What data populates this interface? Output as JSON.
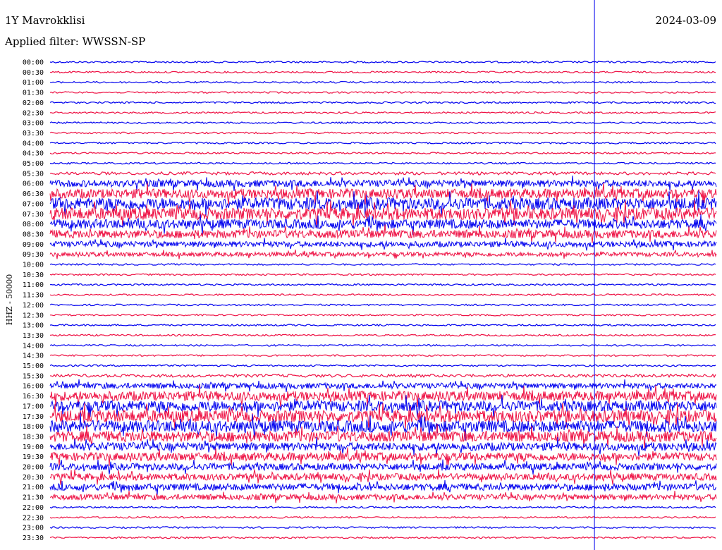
{
  "header": {
    "station": "1Y Mavrokklisi",
    "date": "2024-03-09",
    "filter": "Applied filter: WWSSN-SP"
  },
  "chart_data": {
    "type": "line",
    "ylabel": "HHZ - 50000",
    "rows": [
      "00:00",
      "00:30",
      "01:00",
      "01:30",
      "02:00",
      "02:30",
      "03:00",
      "03:30",
      "04:00",
      "04:30",
      "05:00",
      "05:30",
      "06:00",
      "06:30",
      "07:00",
      "07:30",
      "08:00",
      "08:30",
      "09:00",
      "09:30",
      "10:00",
      "10:30",
      "11:00",
      "11:30",
      "12:00",
      "12:30",
      "13:00",
      "13:30",
      "14:00",
      "14:30",
      "15:00",
      "15:30",
      "16:00",
      "16:30",
      "17:00",
      "17:30",
      "18:00",
      "18:30",
      "19:00",
      "19:30",
      "20:00",
      "20:30",
      "21:00",
      "21:30",
      "22:00",
      "22:30",
      "23:00",
      "23:30"
    ],
    "row_amplitude": [
      1,
      1,
      1,
      1,
      1,
      1,
      1,
      1,
      1,
      1,
      1,
      2,
      5,
      7,
      9,
      9,
      7,
      6,
      4,
      3,
      1,
      1,
      1,
      1,
      1,
      1,
      1,
      1,
      1,
      1,
      1,
      2,
      4,
      7,
      8,
      9,
      9,
      8,
      6,
      6,
      5,
      5,
      5,
      4,
      1,
      1,
      1,
      1
    ],
    "series_colors": [
      "#0000ee",
      "#ee1144"
    ],
    "marker_line_fraction": 0.817,
    "xlim": [
      0,
      30
    ]
  }
}
